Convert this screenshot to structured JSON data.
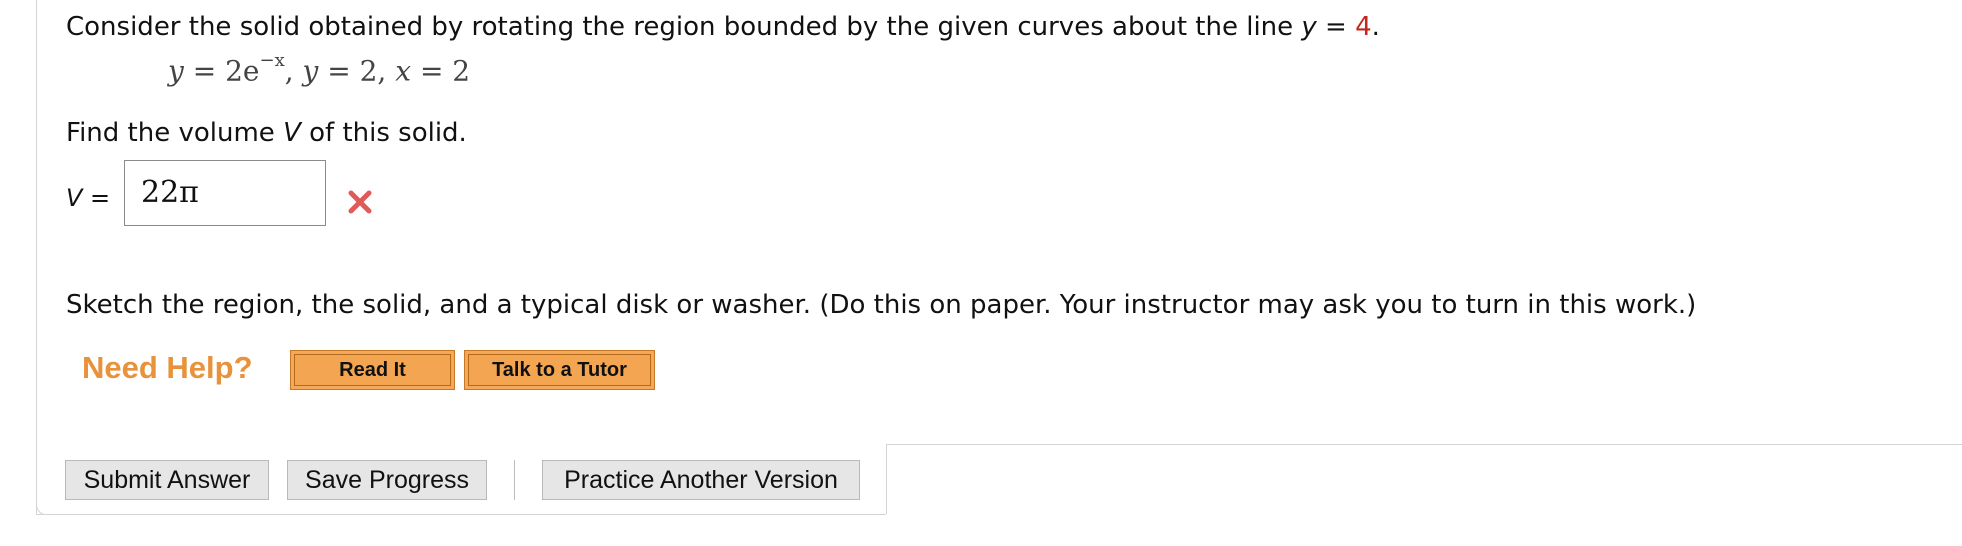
{
  "question": {
    "intro": "Consider the solid obtained by rotating the region bounded by the given curves about the line ",
    "axis_var": "y",
    "axis_eq": " = ",
    "axis_value": "4",
    "period": "."
  },
  "math": {
    "y1": "y",
    "eq1": " = 2e",
    "exp": "−x",
    "rest1": ", ",
    "y2": "y",
    "rest2": " = 2, ",
    "x": "x",
    "rest3": " = 2"
  },
  "find": {
    "before": "Find the volume ",
    "var": "V",
    "after": " of this solid."
  },
  "answer": {
    "label_var": "V",
    "label_eq": " =",
    "value": "22π",
    "status_icon": "x-mark-icon",
    "status_color": "#e05a5a"
  },
  "sketch_text": "Sketch the region, the solid, and a typical disk or washer. (Do this on paper. Your instructor may ask you to turn in this work.)",
  "help": {
    "label": "Need Help?",
    "read_it": "Read It",
    "talk_tutor": "Talk to a Tutor",
    "accent": "#e8923b"
  },
  "actions": {
    "submit": "Submit Answer",
    "save": "Save Progress",
    "practice": "Practice Another Version"
  }
}
